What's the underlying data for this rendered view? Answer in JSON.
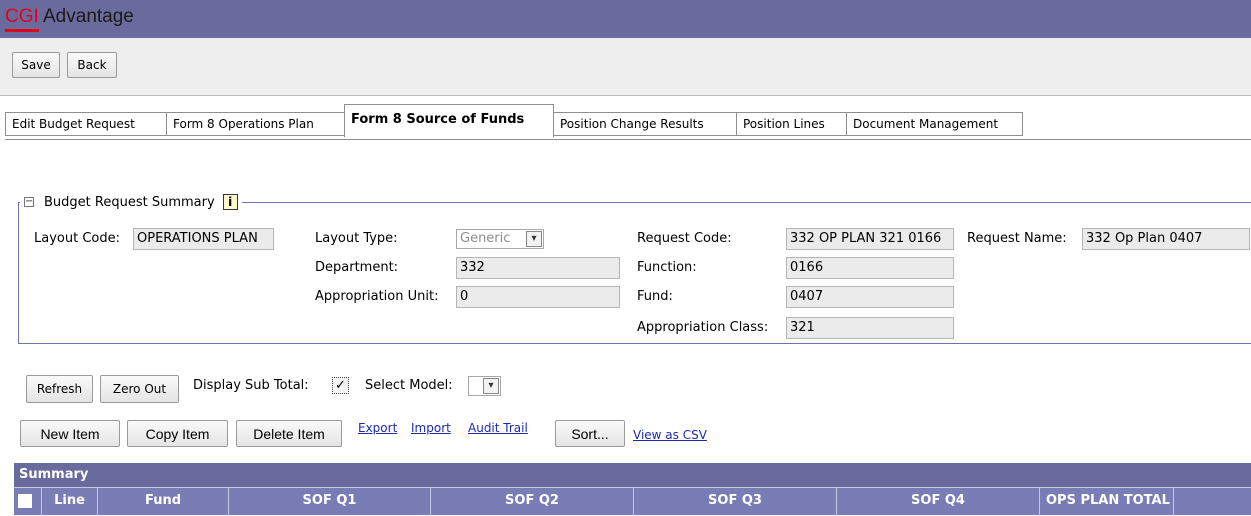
{
  "app": {
    "logo_cgi": "CGI",
    "logo_rest": " Advantage"
  },
  "toolbar": {
    "save": "Save",
    "back": "Back"
  },
  "tabs": [
    "Edit Budget Request",
    "Form 8 Operations Plan",
    "Form 8 Source of Funds",
    "Position Change Results",
    "Position Lines",
    "Document Management"
  ],
  "active_tab": "Form 8 Source of Funds",
  "summary": {
    "legend": "Budget Request Summary",
    "collapse_glyph": "−",
    "info_glyph": "i",
    "layout_code_label": "Layout Code:",
    "layout_code": "OPERATIONS PLAN",
    "layout_type_label": "Layout Type:",
    "layout_type": "Generic",
    "department_label": "Department:",
    "department": "332",
    "approp_unit_label": "Appropriation Unit:",
    "approp_unit": "0",
    "request_code_label": "Request Code:",
    "request_code": "332 OP PLAN 321 0166",
    "request_name_label": "Request Name:",
    "request_name": "332 Op Plan 0407",
    "function_label": "Function:",
    "function": "0166",
    "fund_label": "Fund:",
    "fund": "0407",
    "approp_class_label": "Appropriation Class:",
    "approp_class": "321"
  },
  "actions": {
    "refresh": "Refresh",
    "zero_out": "Zero Out",
    "display_sub_total_label": "Display Sub Total:",
    "display_sub_total_checked": true,
    "checkmark": "✓",
    "select_model_label": "Select Model:",
    "dropdown_glyph": "▾"
  },
  "item_actions": {
    "new_item": "New Item",
    "copy_item": "Copy Item",
    "delete_item": "Delete Item",
    "export": "Export",
    "import": "Import",
    "audit_trail": "Audit Trail",
    "sort": "Sort...",
    "view_csv": "View as CSV"
  },
  "grid": {
    "title": "Summary",
    "columns": [
      "Line",
      "Fund",
      "SOF Q1",
      "SOF Q2",
      "SOF Q3",
      "SOF Q4",
      "OPS PLAN TOTAL"
    ]
  },
  "colors": {
    "header": "#686b9c",
    "grid_header": "#7a7db5",
    "logo_red": "#e2001a",
    "link": "#1d2aaf"
  }
}
